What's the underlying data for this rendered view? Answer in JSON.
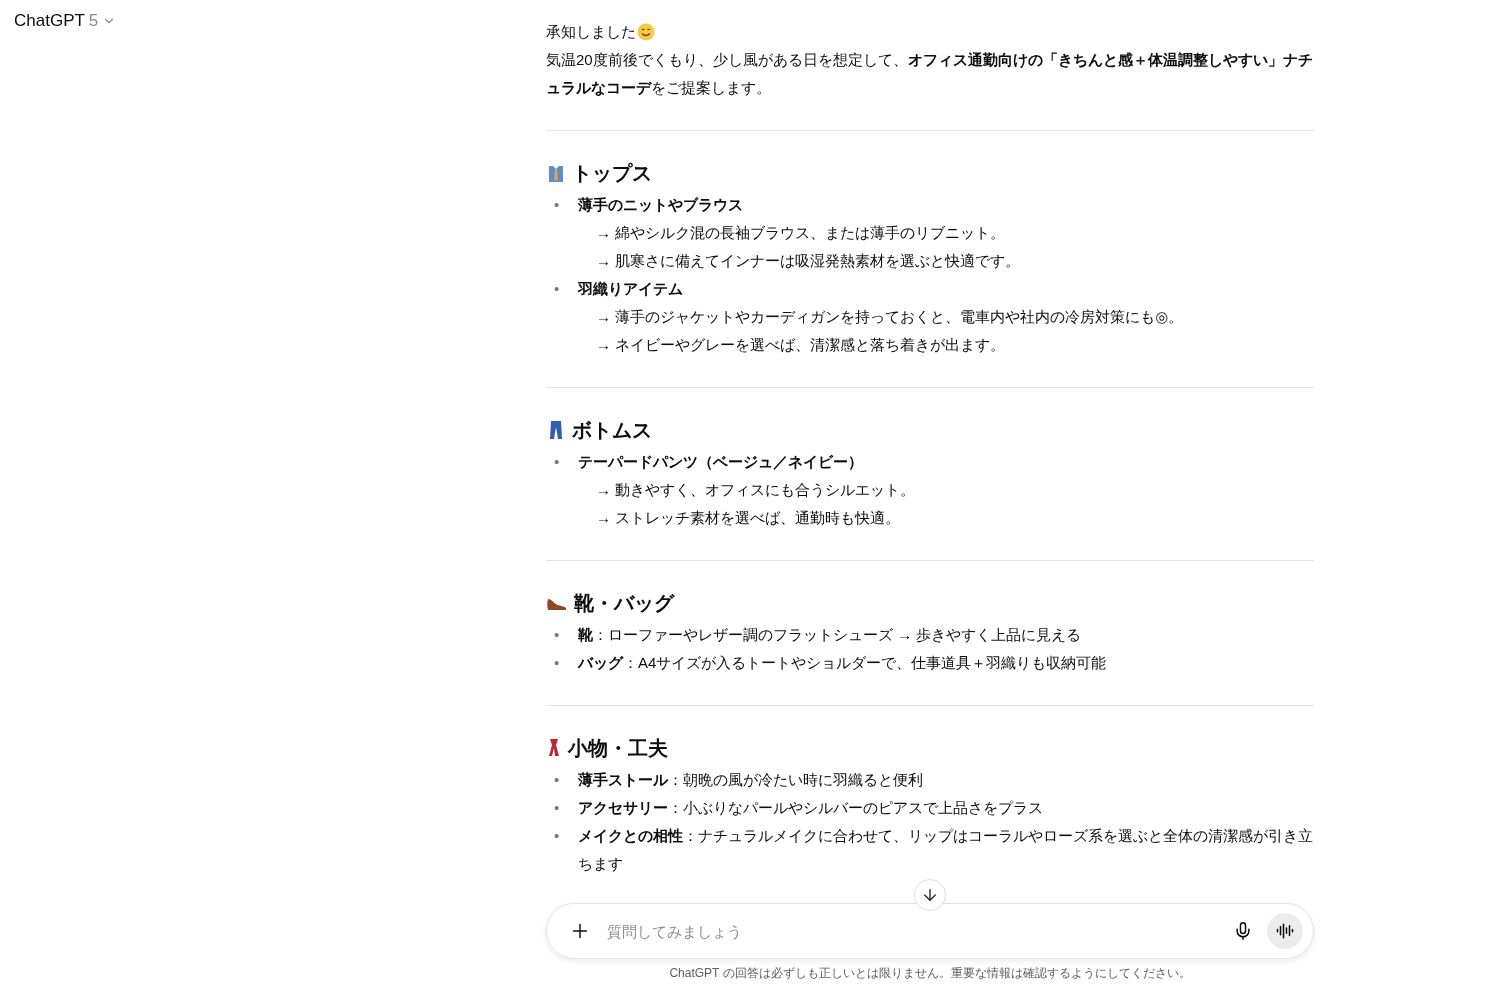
{
  "header": {
    "title": "ChatGPT",
    "version": "5"
  },
  "message": {
    "greeting": "承知しました",
    "intro": "気温20度前後でくもり、少し風がある日を想定して、**オフィス通勤向けの「きちんと感＋体温調整しやすい」ナチュラルなコーデ**をご提案します。"
  },
  "sections": [
    {
      "kind": "shirt",
      "heading": "トップス",
      "items": [
        {
          "kind": "label",
          "marker": "•",
          "text": "薄手のニットやブラウス",
          "notes": [
            "→ 綿やシルク混の長袖ブラウス、または薄手のリブニット。",
            "→ 肌寒さに備えてインナーは吸湿発熱素材を選ぶと快適です。"
          ]
        },
        {
          "kind": "label",
          "marker": "•",
          "text": "羽織りアイテム",
          "notes": [
            "→ 薄手のジャケットやカーディガンを持っておくと、電車内や社内の冷房対策にも◎。",
            "→ ネイビーやグレーを選べば、清潔感と落ち着きが出ます。"
          ]
        }
      ]
    },
    {
      "kind": "jeans",
      "heading": "ボトムス",
      "items": [
        {
          "kind": "label",
          "marker": "•",
          "text": "テーパードパンツ（ベージュ／ネイビー）",
          "notes": [
            "→ 動きやすく、オフィスにも合うシルエット。",
            "→ ストレッチ素材を選べば、通勤時も快適。"
          ]
        }
      ]
    },
    {
      "kind": "shoe",
      "heading": "靴・バッグ",
      "items": [
        {
          "kind": "text",
          "marker": "•",
          "text": "**靴**：ローファーやレザー調のフラットシューズ → 歩きやすく上品に見える"
        },
        {
          "kind": "text",
          "marker": "•",
          "text": "**バッグ**：A4サイズが入るトートやショルダーで、仕事道具＋羽織りも収納可能"
        }
      ]
    },
    {
      "kind": "scarf",
      "heading": "小物・工夫",
      "items": [
        {
          "kind": "text",
          "marker": "•",
          "text": "**薄手ストール**：朝晩の風が冷たい時に羽織ると便利"
        },
        {
          "kind": "text",
          "marker": "•",
          "text": "**アクセサリー**：小ぶりなパールやシルバーのピアスで上品さをプラス"
        },
        {
          "kind": "text",
          "marker": "•",
          "text": "**メイクとの相性**：ナチュラルメイクに合わせて、リップはコーラルやローズ系を選ぶと全体の清潔感が引き立ちます"
        }
      ]
    }
  ],
  "composer": {
    "placeholder": "質問してみましょう"
  },
  "disclaimer": "ChatGPT の回答は必ずしも正しいとは限りません。重要な情報は確認するようにしてください。"
}
